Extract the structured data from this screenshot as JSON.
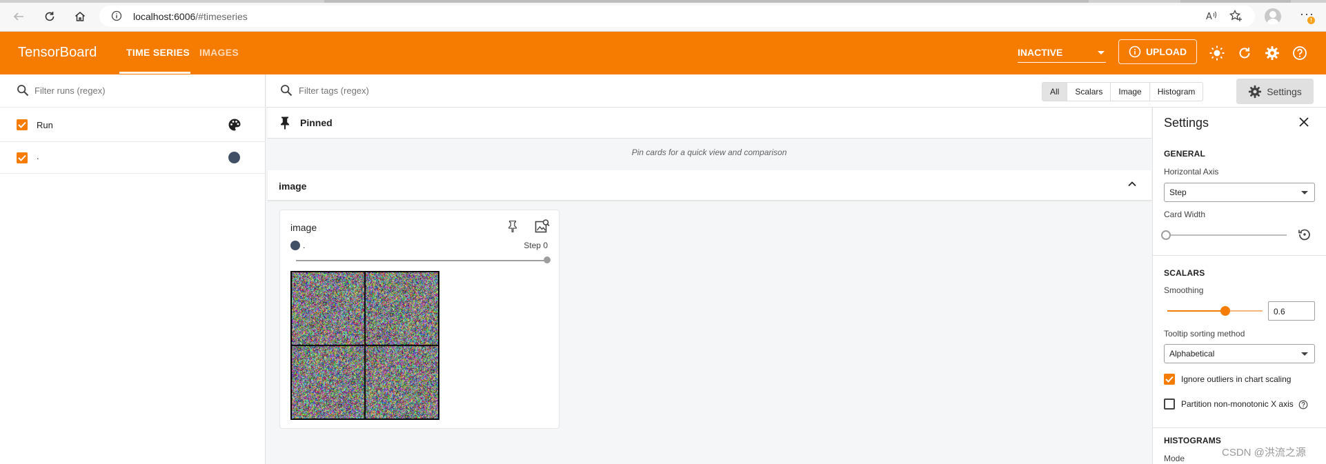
{
  "browser": {
    "url_host": "localhost:6006",
    "url_path": "/#timeseries"
  },
  "header": {
    "brand": "TensorBoard",
    "tabs": [
      {
        "label": "TIME SERIES",
        "active": true
      },
      {
        "label": "IMAGES",
        "active": false
      }
    ],
    "status_select": "INACTIVE",
    "upload_label": "UPLOAD"
  },
  "sidebar": {
    "filter_placeholder": "Filter runs (regex)",
    "header_label": "Run",
    "runs": [
      {
        "name": ".",
        "checked": true,
        "color": "#425066"
      }
    ]
  },
  "main": {
    "filter_placeholder": "Filter tags (regex)",
    "type_filters": [
      "All",
      "Scalars",
      "Image",
      "Histogram"
    ],
    "active_type_filter": "All",
    "settings_button": "Settings",
    "pinned": {
      "label": "Pinned",
      "empty_message": "Pin cards for a quick view and comparison"
    },
    "group": {
      "label": "image"
    },
    "card": {
      "title": "image",
      "run_label": ".",
      "step_label": "Step 0"
    }
  },
  "settings_panel": {
    "title": "Settings",
    "general": {
      "heading": "GENERAL",
      "horizontal_axis_label": "Horizontal Axis",
      "horizontal_axis_value": "Step",
      "card_width_label": "Card Width"
    },
    "scalars": {
      "heading": "SCALARS",
      "smoothing_label": "Smoothing",
      "smoothing_value": "0.6",
      "tooltip_label": "Tooltip sorting method",
      "tooltip_value": "Alphabetical",
      "ignore_outliers_label": "Ignore outliers in chart scaling",
      "ignore_outliers_checked": true,
      "partition_label": "Partition non-monotonic X axis",
      "partition_checked": false
    },
    "histograms": {
      "heading": "HISTOGRAMS",
      "mode_label": "Mode"
    }
  },
  "watermark": "CSDN @洪流之源",
  "colors": {
    "accent": "#f57c00",
    "run_color": "#425066"
  }
}
